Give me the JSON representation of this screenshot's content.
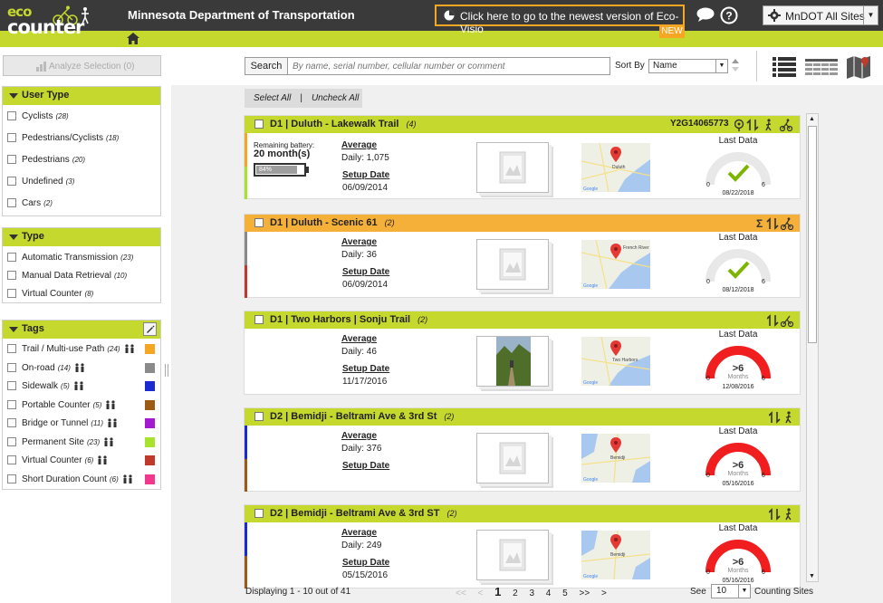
{
  "header": {
    "logo_top": "eco",
    "logo_bottom": "counter",
    "title": "Minnesota Department of Transportation",
    "notice": "Click here to go to the newest version of Eco-Visio",
    "new_badge": "NEW",
    "site_select": "MnDOT All Sites"
  },
  "left": {
    "analyze": "Analyze Selection (0)",
    "user_type": {
      "title": "User Type",
      "items": [
        {
          "label": "Cyclists",
          "count": "(28)"
        },
        {
          "label": "Pedestrians/Cyclists",
          "count": "(18)"
        },
        {
          "label": "Pedestrians",
          "count": "(20)"
        },
        {
          "label": "Undefined",
          "count": "(3)"
        },
        {
          "label": "Cars",
          "count": "(2)"
        }
      ]
    },
    "type": {
      "title": "Type",
      "items": [
        {
          "label": "Automatic Transmission",
          "count": "(23)"
        },
        {
          "label": "Manual Data Retrieval",
          "count": "(10)"
        },
        {
          "label": "Virtual Counter",
          "count": "(8)"
        }
      ]
    },
    "tags": {
      "title": "Tags",
      "items": [
        {
          "label": "Trail / Multi-use Path",
          "count": "(24)",
          "color": "#f5a623"
        },
        {
          "label": "On-road",
          "count": "(14)",
          "color": "#8a8a8a"
        },
        {
          "label": "Sidewalk",
          "count": "(5)",
          "color": "#1a2bd1"
        },
        {
          "label": "Portable Counter",
          "count": "(5)",
          "color": "#9c5a14"
        },
        {
          "label": "Bridge or Tunnel",
          "count": "(11)",
          "color": "#a31ad1"
        },
        {
          "label": "Permanent Site",
          "count": "(23)",
          "color": "#a6e22e"
        },
        {
          "label": "Virtual Counter",
          "count": "(6)",
          "color": "#c0392b"
        },
        {
          "label": "Short Duration Count",
          "count": "(6)",
          "color": "#f0388c"
        }
      ]
    }
  },
  "toolbar": {
    "search_label": "Search",
    "search_placeholder": "By name, serial number, cellular number or comment",
    "sort_label": "Sort By",
    "sort_value": "Name"
  },
  "select_bar": {
    "select_all": "Select All",
    "separator": "|",
    "uncheck_all": "Uncheck All"
  },
  "sites": [
    {
      "name": "D1 | Duluth - Lakewalk Trail",
      "count": "(4)",
      "serial": "Y2G14065773",
      "head_color": "#c5d82e",
      "stripe_top": "#f5a623",
      "stripe_bottom": "#a6e22e",
      "battery_label": "Remaining battery:",
      "battery_value": "20 month(s)",
      "battery_pct": "84%",
      "battery_level": 0.84,
      "avg_label": "Average",
      "daily": "Daily: 1,075",
      "setup_label": "Setup Date",
      "setup_date": "06/09/2014",
      "last_data": "Last Data",
      "status": "ok",
      "gauge_big": "",
      "gauge_unit": "",
      "gauge_min": "0",
      "gauge_max": "6",
      "gauge_date": "08/22/2018",
      "map_label": "Duluth",
      "photo": "placeholder"
    },
    {
      "name": "D1 | Duluth - Scenic 61",
      "count": "(2)",
      "serial": "",
      "head_color": "#f5b03a",
      "stripe_top": "#8a8a8a",
      "stripe_bottom": "#c0392b",
      "battery_label": "",
      "battery_value": "",
      "battery_pct": "",
      "battery_level": 0,
      "avg_label": "Average",
      "daily": "Daily: 36",
      "setup_label": "Setup Date",
      "setup_date": "06/09/2014",
      "last_data": "Last Data",
      "status": "ok",
      "gauge_big": "",
      "gauge_unit": "",
      "gauge_min": "0",
      "gauge_max": "6",
      "gauge_date": "08/12/2018",
      "map_label": "French River",
      "photo": "placeholder"
    },
    {
      "name": "D1 | Two Harbors | Sonju Trail",
      "count": "(2)",
      "serial": "",
      "head_color": "#c5d82e",
      "stripe_top": "",
      "stripe_bottom": "",
      "battery_label": "",
      "battery_value": "",
      "battery_pct": "",
      "battery_level": 0,
      "avg_label": "Average",
      "daily": "Daily: 46",
      "setup_label": "Setup Date",
      "setup_date": "11/17/2016",
      "last_data": "Last Data",
      "status": "late",
      "gauge_big": ">6",
      "gauge_unit": "Months",
      "gauge_min": "0",
      "gauge_max": "6",
      "gauge_date": "12/08/2016",
      "map_label": "Two Harbors",
      "photo": "trail"
    },
    {
      "name": "D2 | Bemidji - Beltrami Ave & 3rd St",
      "count": "(2)",
      "serial": "",
      "head_color": "#c5d82e",
      "stripe_top": "#1a2bd1",
      "stripe_bottom": "#9c5a14",
      "battery_label": "",
      "battery_value": "",
      "battery_pct": "",
      "battery_level": 0,
      "avg_label": "Average",
      "daily": "Daily: 376",
      "setup_label": "Setup Date",
      "setup_date": "",
      "last_data": "Last Data",
      "status": "late",
      "gauge_big": ">6",
      "gauge_unit": "Months",
      "gauge_min": "0",
      "gauge_max": "6",
      "gauge_date": "05/16/2016",
      "map_label": "Bemidji",
      "photo": "placeholder"
    },
    {
      "name": "D2 | Bemidji - Beltrami Ave & 3rd ST",
      "count": "(2)",
      "serial": "",
      "head_color": "#c5d82e",
      "stripe_top": "#1a2bd1",
      "stripe_bottom": "#9c5a14",
      "battery_label": "",
      "battery_value": "",
      "battery_pct": "",
      "battery_level": 0,
      "avg_label": "Average",
      "daily": "Daily: 249",
      "setup_label": "Setup Date",
      "setup_date": "05/15/2016",
      "last_data": "Last Data",
      "status": "late",
      "gauge_big": ">6",
      "gauge_unit": "Months",
      "gauge_min": "0",
      "gauge_max": "6",
      "gauge_date": "05/16/2016",
      "map_label": "Bemidji",
      "photo": "placeholder"
    }
  ],
  "footer": {
    "displaying": "Displaying 1 - 10 out of 41",
    "first": "<<",
    "prev": "<",
    "pages": [
      "1",
      "2",
      "3",
      "4",
      "5"
    ],
    "current_page": "1",
    "next_group": ">>",
    "next": ">",
    "see_label": "See",
    "per_page": "10",
    "counting_label": "Counting Sites"
  }
}
